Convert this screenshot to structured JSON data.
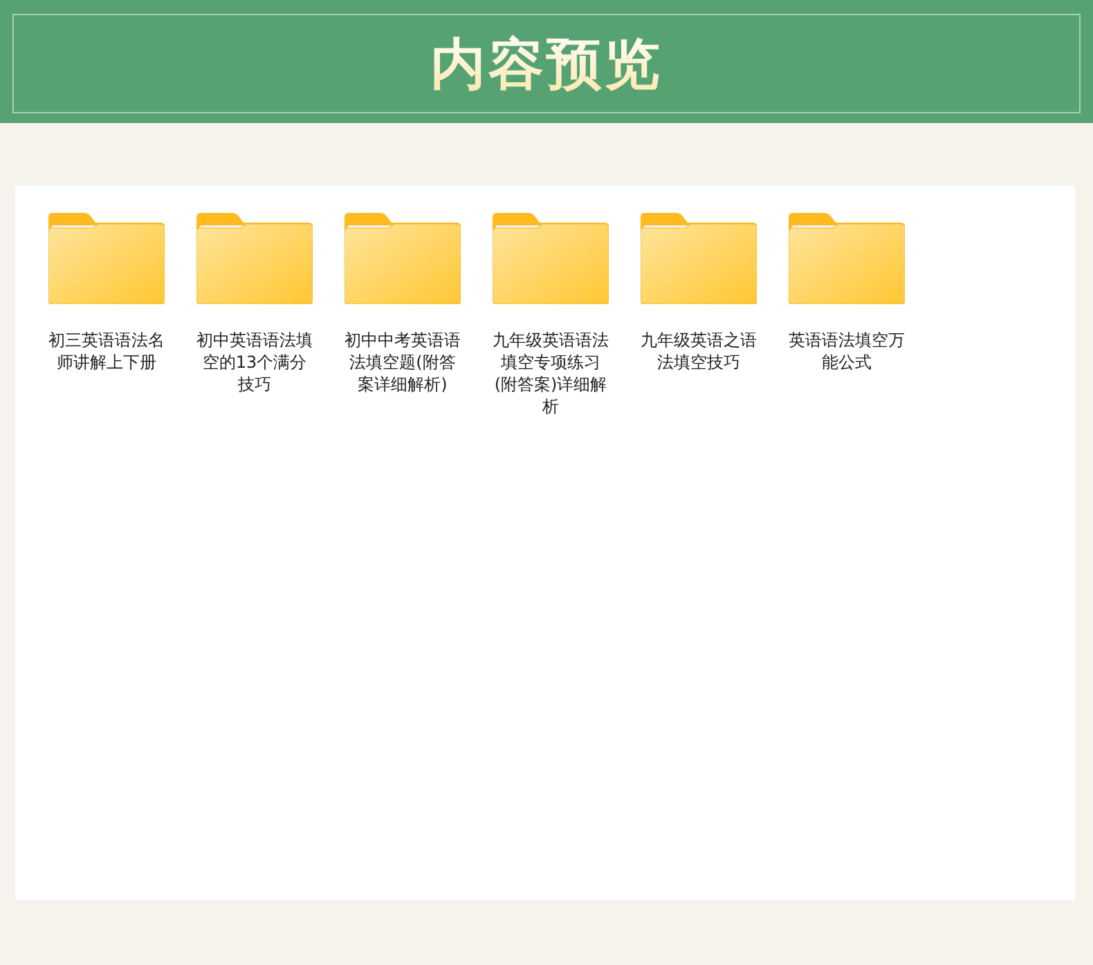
{
  "header": {
    "title": "内容预览"
  },
  "folders": [
    {
      "name": "初三英语语法名师讲解上下册"
    },
    {
      "name": "初中英语语法填空的13个满分技巧"
    },
    {
      "name": "初中中考英语语法填空题(附答案详细解析)"
    },
    {
      "name": "九年级英语语法填空专项练习(附答案)详细解析"
    },
    {
      "name": "九年级英语之语法填空技巧"
    },
    {
      "name": "英语语法填空万能公式"
    }
  ]
}
